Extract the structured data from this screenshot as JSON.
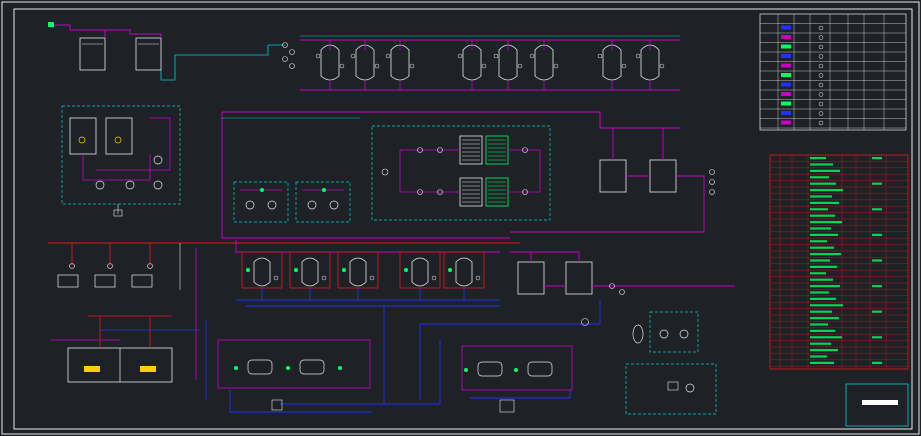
{
  "colors": {
    "background": "#1e2226",
    "frame": "#e8e8e8",
    "pipe_magenta": "#c800c8",
    "pipe_red": "#e01818",
    "pipe_blue": "#2030ff",
    "pipe_cyan": "#00d0d0",
    "equipment": "#e8e8e8",
    "instrument_green": "#00ff66",
    "legend_border": "#e8e8e8"
  },
  "drawing": {
    "caption_near_bottom": "",
    "legend_title": "",
    "equipment_list_footer": ""
  },
  "icons": [
    "valve-icon",
    "pump-icon",
    "filter-vessel-icon",
    "tank-icon",
    "heat-exchanger-icon",
    "instrument-icon"
  ]
}
